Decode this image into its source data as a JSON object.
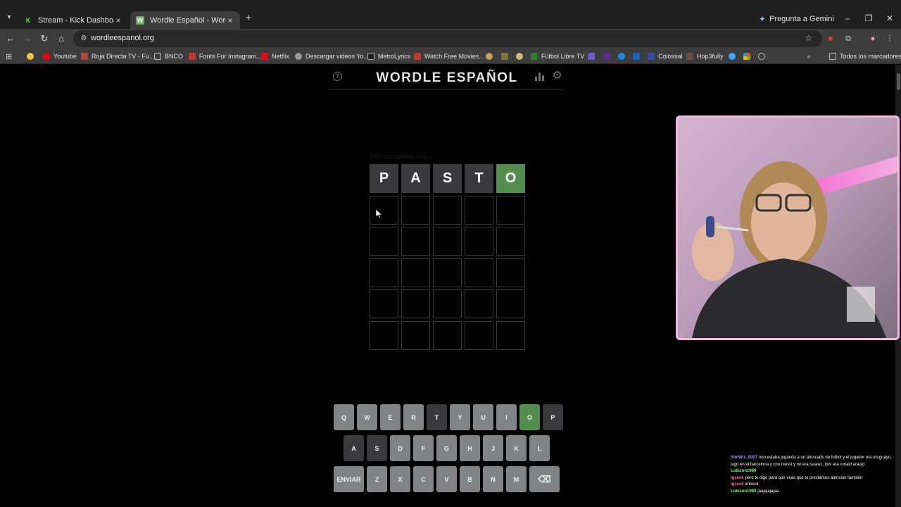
{
  "browser": {
    "tabs": [
      {
        "title": "Stream - Kick Dashboard",
        "favicon": "K",
        "favicon_color": "#53fc18",
        "active": false
      },
      {
        "title": "Wordle Español - Wordle ilimita",
        "favicon": "W",
        "favicon_color": "#6aaa64",
        "active": true
      }
    ],
    "gemini_label": "Pregunta a Gemini",
    "url": "wordleespanol.org",
    "bookmarks": [
      {
        "label": "",
        "color": "#f5c542"
      },
      {
        "label": "Youtube",
        "color": "#ff0000"
      },
      {
        "label": "Roja Directa TV - Fu...",
        "color": "#d33"
      },
      {
        "label": "BNCO",
        "color": "#777"
      },
      {
        "label": "Fonts For Instagram...",
        "color": "#c0392b"
      },
      {
        "label": "Netflix",
        "color": "#e50914"
      },
      {
        "label": "Descargar videos Yo...",
        "color": "#888"
      },
      {
        "label": "MetroLyrics",
        "color": "#333"
      },
      {
        "label": "Watch Free Movies...",
        "color": "#c0392b"
      },
      {
        "label": "Fútbol Libre TV",
        "color": "#2e7d32"
      },
      {
        "label": "Colossal",
        "color": "#3949ab"
      },
      {
        "label": "Hop3fully",
        "color": "#6d4c41"
      },
      {
        "label": "Todos los marcadores",
        "color": "#999"
      }
    ]
  },
  "game": {
    "title": "WORDLE ESPAÑOL",
    "faint_message": "Por completar hoy...",
    "board": [
      [
        {
          "letter": "P",
          "state": "absent"
        },
        {
          "letter": "A",
          "state": "absent"
        },
        {
          "letter": "S",
          "state": "absent"
        },
        {
          "letter": "T",
          "state": "absent"
        },
        {
          "letter": "O",
          "state": "correct"
        }
      ],
      [
        {
          "letter": "",
          "state": "empty"
        },
        {
          "letter": "",
          "state": "empty"
        },
        {
          "letter": "",
          "state": "empty"
        },
        {
          "letter": "",
          "state": "empty"
        },
        {
          "letter": "",
          "state": "empty"
        }
      ],
      [
        {
          "letter": "",
          "state": "empty"
        },
        {
          "letter": "",
          "state": "empty"
        },
        {
          "letter": "",
          "state": "empty"
        },
        {
          "letter": "",
          "state": "empty"
        },
        {
          "letter": "",
          "state": "empty"
        }
      ],
      [
        {
          "letter": "",
          "state": "empty"
        },
        {
          "letter": "",
          "state": "empty"
        },
        {
          "letter": "",
          "state": "empty"
        },
        {
          "letter": "",
          "state": "empty"
        },
        {
          "letter": "",
          "state": "empty"
        }
      ],
      [
        {
          "letter": "",
          "state": "empty"
        },
        {
          "letter": "",
          "state": "empty"
        },
        {
          "letter": "",
          "state": "empty"
        },
        {
          "letter": "",
          "state": "empty"
        },
        {
          "letter": "",
          "state": "empty"
        }
      ],
      [
        {
          "letter": "",
          "state": "empty"
        },
        {
          "letter": "",
          "state": "empty"
        },
        {
          "letter": "",
          "state": "empty"
        },
        {
          "letter": "",
          "state": "empty"
        },
        {
          "letter": "",
          "state": "empty"
        }
      ]
    ],
    "keyboard": [
      [
        {
          "k": "Q",
          "s": "unused"
        },
        {
          "k": "W",
          "s": "unused"
        },
        {
          "k": "E",
          "s": "unused"
        },
        {
          "k": "R",
          "s": "unused"
        },
        {
          "k": "T",
          "s": "absent"
        },
        {
          "k": "Y",
          "s": "unused"
        },
        {
          "k": "U",
          "s": "unused"
        },
        {
          "k": "I",
          "s": "unused"
        },
        {
          "k": "O",
          "s": "correct"
        },
        {
          "k": "P",
          "s": "absent"
        }
      ],
      [
        {
          "k": "A",
          "s": "absent"
        },
        {
          "k": "S",
          "s": "absent"
        },
        {
          "k": "D",
          "s": "unused"
        },
        {
          "k": "F",
          "s": "unused"
        },
        {
          "k": "G",
          "s": "unused"
        },
        {
          "k": "H",
          "s": "unused"
        },
        {
          "k": "J",
          "s": "unused"
        },
        {
          "k": "K",
          "s": "unused"
        },
        {
          "k": "L",
          "s": "unused"
        }
      ],
      [
        {
          "k": "ENVIAR",
          "s": "unused"
        },
        {
          "k": "Z",
          "s": "unused"
        },
        {
          "k": "X",
          "s": "unused"
        },
        {
          "k": "C",
          "s": "unused"
        },
        {
          "k": "V",
          "s": "unused"
        },
        {
          "k": "B",
          "s": "unused"
        },
        {
          "k": "N",
          "s": "unused"
        },
        {
          "k": "M",
          "s": "unused"
        },
        {
          "k": "⌫",
          "s": "unused"
        }
      ]
    ],
    "colors": {
      "absent": "#3a3a3c",
      "correct": "#538d4e",
      "unused": "#818384"
    }
  },
  "chat": [
    {
      "user": "SimWiz_0007",
      "color": "#b48cff",
      "text": "noo estaba jugando a un ahorcado de futbol y el jugador era uruguayo, jugo en el barcelona y con messi y no era suarez, lpm era ronald araujo"
    },
    {
      "user": "Lobizon1989",
      "color": "#7cfc7c",
      "text": ""
    },
    {
      "user": "lgseek",
      "color": "#ff69b4",
      "text": "pero te digo para que veas que te prestamos atencion también"
    },
    {
      "user": "lgseek",
      "color": "#ff69b4",
      "text": "imbecil"
    },
    {
      "user": "Lobizon1989",
      "color": "#7cfc7c",
      "text": "jaajajajajaa"
    }
  ]
}
